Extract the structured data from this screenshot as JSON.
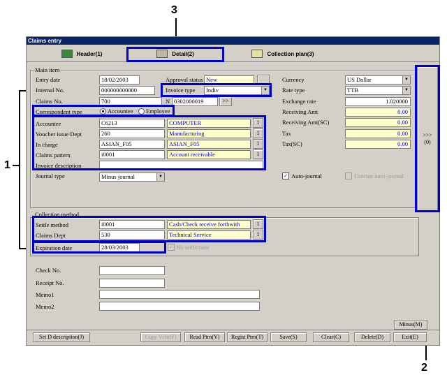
{
  "window": {
    "title": "Claims entry"
  },
  "tabs": [
    {
      "label": "Header(1)"
    },
    {
      "label": "Detail(2)"
    },
    {
      "label": "Collection plan(3)"
    }
  ],
  "callouts": {
    "one": "1",
    "two": "2",
    "three": "3"
  },
  "main_item": {
    "group_label": "Main item",
    "entry_date_label": "Entry date",
    "entry_date": "18/02/2003",
    "internal_no_label": "Internal No.",
    "internal_no": "000000000000",
    "approval_status_label": "Approval status",
    "approval_status": "New",
    "invoice_type_label": "Invoice type",
    "invoice_type": "Indiv",
    "claims_no_label": "Claims No.",
    "claims_no": "700",
    "claims_n_label": "N",
    "claims_n_value": "0302000019",
    "claims_n_button": ">>",
    "correspondent_type_label": "Correspondent type",
    "radio_accountee": "Accountee",
    "radio_employee": "Employee",
    "accountee_label": "Accountee",
    "accountee_code": "C6213",
    "accountee_name": "COMPUTER",
    "voucher_dept_label": "Voucher issue Dept",
    "voucher_dept_code": "260",
    "voucher_dept_name": "Manufacturing",
    "in_charge_label": "In charge",
    "in_charge_code": "ASIAN_F05",
    "in_charge_name": "ASIAN_F05",
    "claims_pattern_label": "Claims pattern",
    "claims_pattern_code": "i0001",
    "claims_pattern_name": "Account receivable",
    "invoice_desc_label": "Invoice description",
    "invoice_desc": "",
    "journal_type_label": "Journal type",
    "journal_type": "Minus journal",
    "lookup_button": "1",
    "currency_label": "Currency",
    "currency": "US Dollar",
    "rate_type_label": "Rate type",
    "rate_type": "TTB",
    "exchange_rate_label": "Exchange rate",
    "exchange_rate": "1.020000",
    "receiving_amt_label": "Receiving Amt",
    "receiving_amt": "0.00",
    "receiving_amt_sc_label": "Receiving Amt(SC)",
    "receiving_amt_sc": "0.00",
    "tax_label": "Tax",
    "tax": "0.00",
    "tax_sc_label": "Tax(SC)",
    "tax_sc": "0.00",
    "auto_journal_label": "Auto-journal",
    "execute_auto_journal_label": "Execute auto-journal",
    "side_button": ">>>(0)"
  },
  "collection": {
    "group_label": "Collection method",
    "settle_method_label": "Settle method",
    "settle_method_code": "i0001",
    "settle_method_name": "Cash/Check receive forthwith",
    "claims_dept_label": "Claims Dept",
    "claims_dept_code": "530",
    "claims_dept_name": "Technical Service",
    "expiration_date_label": "Expiration date",
    "expiration_date": "28/03/2003",
    "no_settlement_label": "No settlement"
  },
  "extra": {
    "check_no_label": "Check No.",
    "receipt_no_label": "Receipt No.",
    "memo1_label": "Memo1",
    "memo2_label": "Memo2"
  },
  "buttons": {
    "minus": "Minus(M)",
    "set_d_description": "Set D description(J)",
    "copy_vchr": "Copy Vchr(F)",
    "read_ptrn": "Read Ptrn(Y)",
    "regist_ptrn": "Regist Ptrn(T)",
    "save": "Save(S)",
    "clear": "Clear(C)",
    "delete": "Delete(D)",
    "exit": "Exit(E)"
  }
}
